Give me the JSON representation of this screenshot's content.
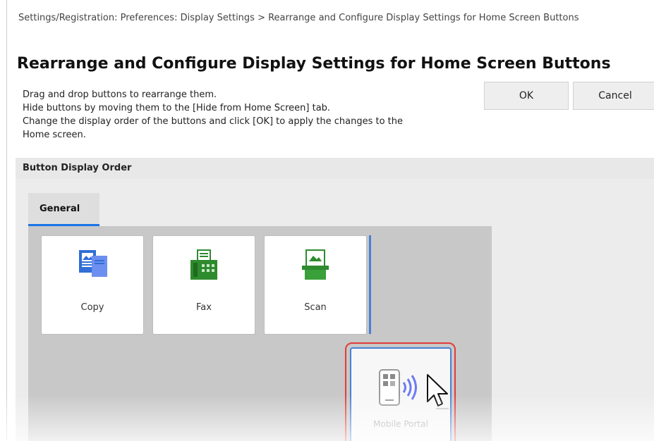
{
  "breadcrumb": "Settings/Registration: Preferences: Display Settings > Rearrange and Configure Display Settings for Home Screen Buttons",
  "page_title": "Rearrange and Configure Display Settings for Home Screen Buttons",
  "instructions": [
    "Drag and drop buttons to rearrange them.",
    "Hide buttons by moving them to the [Hide from Home Screen] tab.",
    "Change the display order of the buttons and click [OK] to apply the changes to the",
    "Home screen."
  ],
  "buttons": {
    "ok": "OK",
    "cancel": "Cancel"
  },
  "section_header": "Button Display Order",
  "tabs": [
    {
      "label": "General",
      "selected": true
    }
  ],
  "tiles": [
    {
      "label": "Copy",
      "icon": "copy-icon"
    },
    {
      "label": "Fax",
      "icon": "fax-icon"
    },
    {
      "label": "Scan",
      "icon": "scan-icon"
    }
  ],
  "dragging_tile": {
    "label": "Mobile Portal",
    "icon": "mobile-portal-icon"
  },
  "colors": {
    "accent": "#1a73e8",
    "drag_highlight": "#e23b3b",
    "copy_icon": "#2f6fd6",
    "fax_icon": "#2e8b2e",
    "scan_icon": "#2e8b2e"
  }
}
